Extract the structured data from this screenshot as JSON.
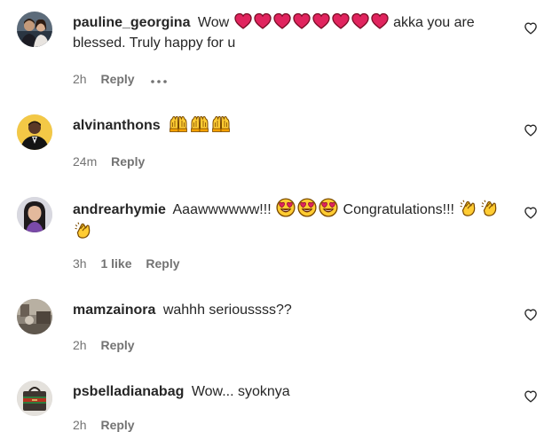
{
  "comments": [
    {
      "username": "pauline_georgina",
      "text_before": "Wow",
      "text_after": "akka you are blessed. Truly happy for u",
      "emojis": "red-heart x8",
      "time": "2h",
      "reply": "Reply",
      "has_more": true,
      "avatar": "couple-photo"
    },
    {
      "username": "alvinanthons",
      "text_before": "",
      "emojis": "raising-hands x3",
      "time": "24m",
      "reply": "Reply",
      "avatar": "man-in-suit-photo"
    },
    {
      "username": "andrearhymie",
      "text_before": "Aaawwwwww!!!",
      "text_middle": "Congratulations!!!",
      "emojis": "heart-eyes x3, clapping-hands x3",
      "time": "3h",
      "likes": "1 like",
      "reply": "Reply",
      "avatar": "woman-photo"
    },
    {
      "username": "mamzainora",
      "text_before": "wahhh serioussss??",
      "time": "2h",
      "reply": "Reply",
      "avatar": "room-photo"
    },
    {
      "username": "psbelladianabag",
      "text_before": "Wow... syoknya",
      "time": "2h",
      "reply": "Reply",
      "avatar": "handbag-photo"
    }
  ],
  "colors": {
    "text": "#262626",
    "secondary": "#737373",
    "heart_emoji": "#e0245e",
    "emoji_yellow": "#ffcc33"
  }
}
